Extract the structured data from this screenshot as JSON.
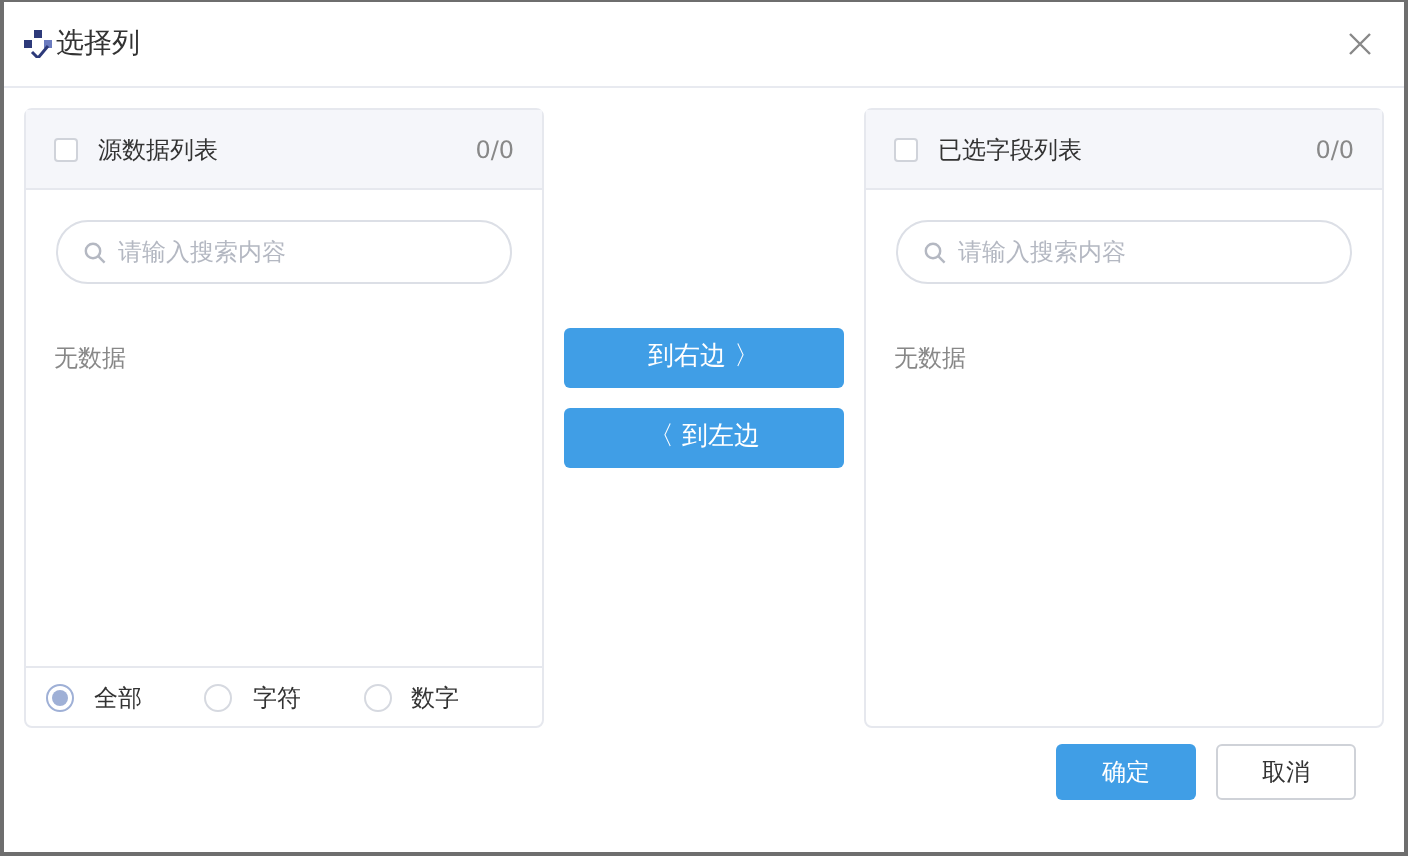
{
  "window": {
    "title": "选择列"
  },
  "panels": [
    {
      "title": "源数据列表",
      "count": "0/0",
      "checked": false,
      "search": {
        "placeholder": "请输入搜索内容"
      },
      "empty_text": "无数据",
      "filters": [
        {
          "label": "全部",
          "selected": true
        },
        {
          "label": "字符",
          "selected": false
        },
        {
          "label": "数字",
          "selected": false
        }
      ]
    },
    {
      "title": "已选字段列表",
      "count": "0/0",
      "checked": false,
      "search": {
        "placeholder": "请输入搜索内容"
      },
      "empty_text": "无数据"
    }
  ],
  "move_buttons": [
    {
      "label": "到右边",
      "kind": "right",
      "arrow": "〉"
    },
    {
      "label": "到左边",
      "kind": "left",
      "arrow": "〈"
    }
  ],
  "footer_buttons": [
    {
      "label": "确定",
      "kind": "primary"
    },
    {
      "label": "取消",
      "kind": "secondary"
    }
  ]
}
